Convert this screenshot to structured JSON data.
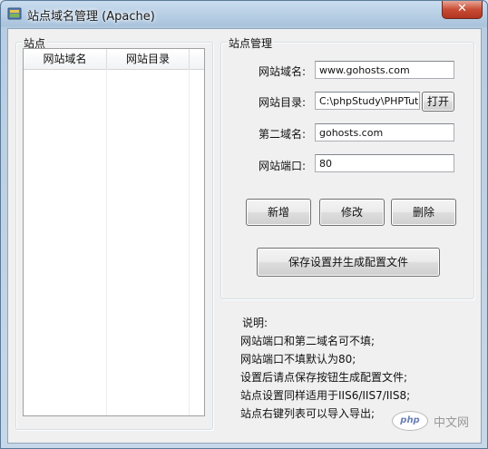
{
  "window": {
    "title": "站点域名管理 (Apache)",
    "close_label": "✕"
  },
  "sites_group": {
    "title": "站点"
  },
  "site_list": {
    "columns": [
      "网站域名",
      "网站目录"
    ],
    "rows": []
  },
  "manage_group": {
    "title": "站点管理",
    "domain_label": "网站域名:",
    "domain_value": "www.gohosts.com",
    "dir_label": "网站目录:",
    "dir_value": "C:\\phpStudy\\PHPTutor",
    "open_label": "打开",
    "second_domain_label": "第二域名:",
    "second_domain_value": "gohosts.com",
    "port_label": "网站端口:",
    "port_value": "80",
    "add_label": "新增",
    "edit_label": "修改",
    "delete_label": "删除",
    "save_label": "保存设置并生成配置文件"
  },
  "notes": {
    "heading": "说明:",
    "lines": [
      "网站端口和第二域名可不填;",
      "网站端口不填默认为80;",
      "设置后请点保存按钮生成配置文件;",
      "站点设置同样适用于IIS6/IIS7/IIS8;",
      "站点右键列表可以导入导出;"
    ]
  },
  "watermark": {
    "logo": "php",
    "text": "中文网"
  }
}
